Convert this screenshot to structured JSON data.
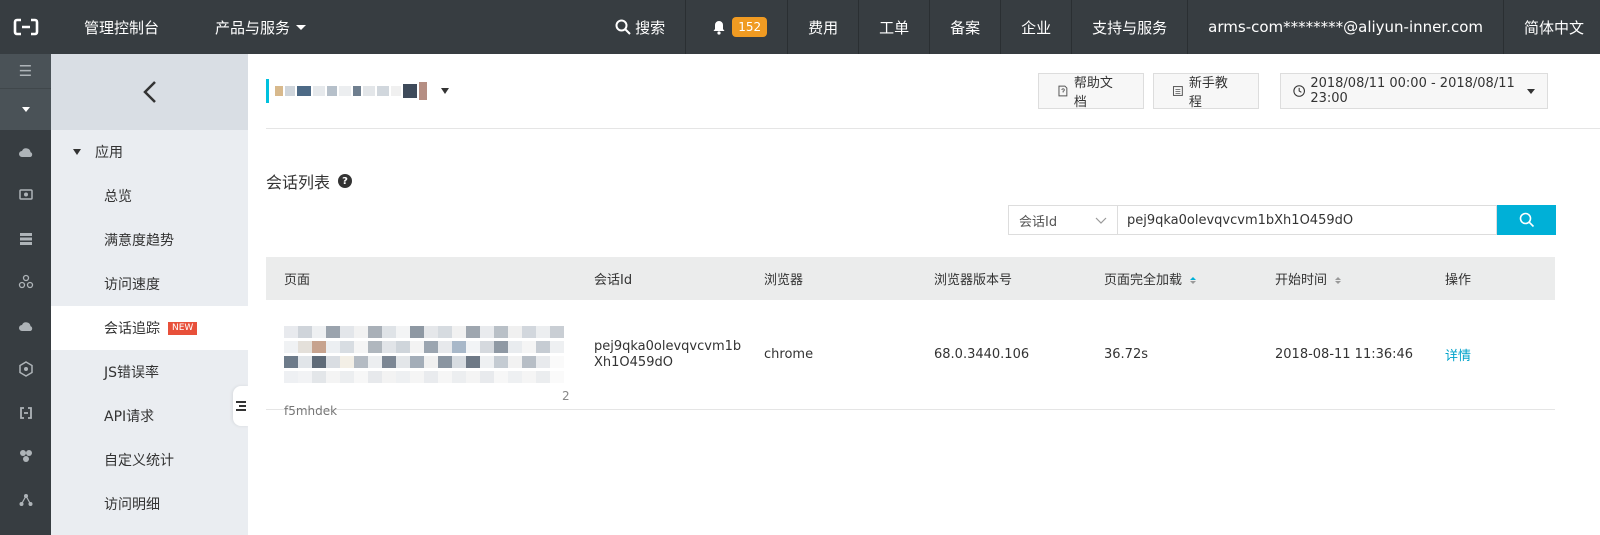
{
  "topbar": {
    "console": "管理控制台",
    "products": "产品与服务",
    "search": "搜索",
    "notifications": "152",
    "links": [
      "费用",
      "工单",
      "备案",
      "企业",
      "支持与服务"
    ],
    "account": "arms-com********@aliyun-inner.com",
    "language": "简体中文"
  },
  "subnav": {
    "group": "应用",
    "items": [
      "总览",
      "满意度趋势",
      "访问速度",
      "会话追踪",
      "JS错误率",
      "API请求",
      "自定义统计",
      "访问明细"
    ],
    "new_tag": "NEW"
  },
  "toolbar": {
    "help_docs": "帮助文档",
    "tutorial": "新手教程",
    "time_range": "2018/08/11 00:00 - 2018/08/11 23:00"
  },
  "section": {
    "title": "会话列表"
  },
  "search": {
    "field": "会话Id",
    "value": "pej9qka0olevqvcvm1bXh1O459dO"
  },
  "table": {
    "headers": [
      "页面",
      "会话Id",
      "浏览器",
      "浏览器版本号",
      "页面完全加载",
      "开始时间",
      "操作"
    ],
    "rows": [
      {
        "page_tail": "f5mhdek",
        "page_suffix": "2",
        "session_id_1": "pej9qka0olevqvcvm1b",
        "session_id_2": "Xh1O459dO",
        "browser": "chrome",
        "version": "68.0.3440.106",
        "load": "36.72s",
        "start": "2018-08-11 11:36:46",
        "action": "详情"
      }
    ]
  }
}
